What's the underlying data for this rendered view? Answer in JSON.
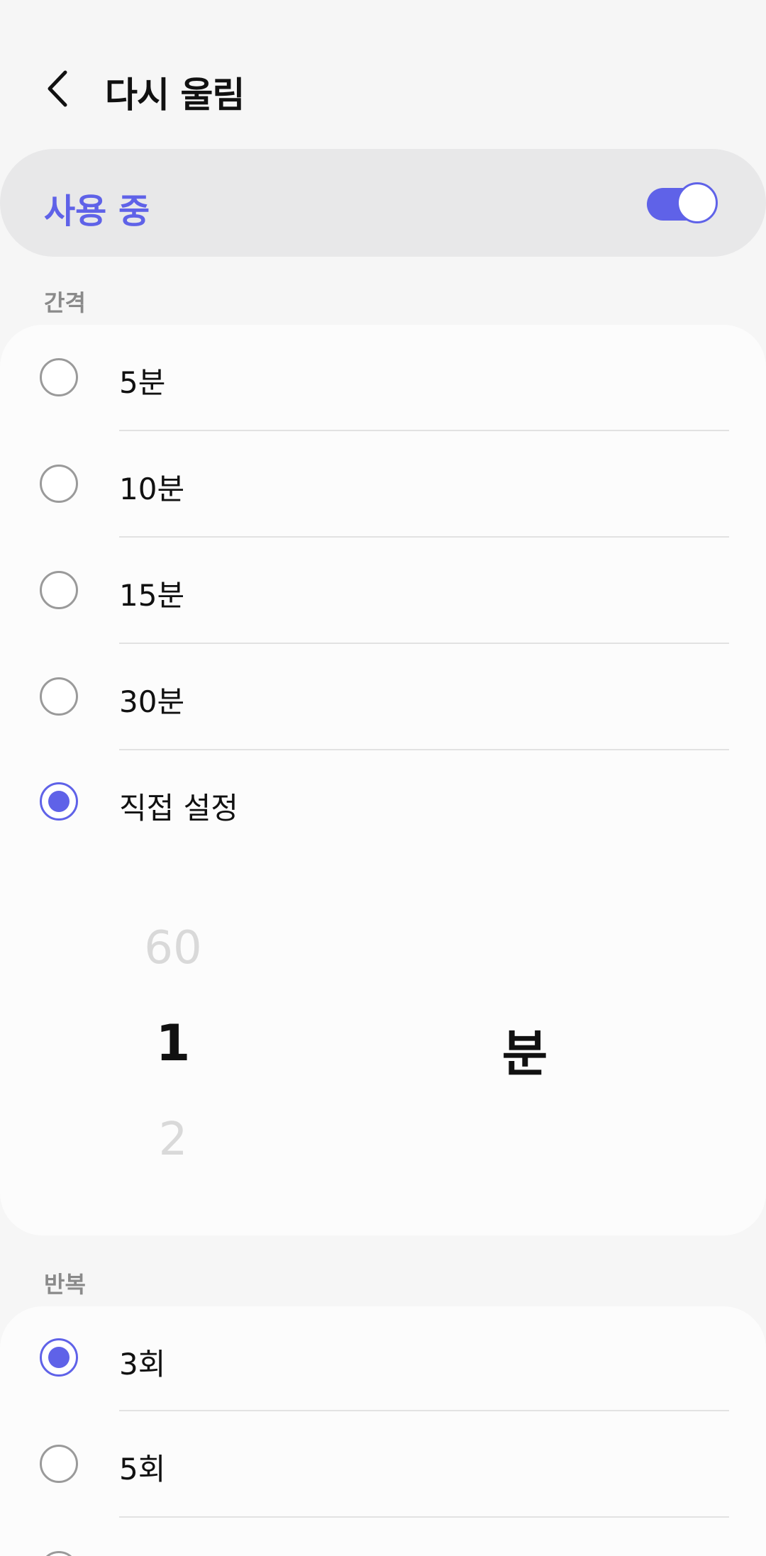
{
  "header": {
    "title": "다시 울림"
  },
  "master": {
    "label": "사용 중",
    "enabled": true
  },
  "interval": {
    "section_label": "간격",
    "options": [
      "5분",
      "10분",
      "15분",
      "30분",
      "직접 설정"
    ],
    "selected_index": 4,
    "picker": {
      "prev": "60",
      "selected": "1",
      "next": "2",
      "unit": "분"
    }
  },
  "repeat": {
    "section_label": "반복",
    "options": [
      "3회",
      "5회"
    ],
    "selected_index": 0
  },
  "colors": {
    "accent": "#5f62e8",
    "background": "#f6f6f6",
    "card": "#fcfcfc"
  },
  "icons": {
    "back": "chevron-left-icon"
  }
}
